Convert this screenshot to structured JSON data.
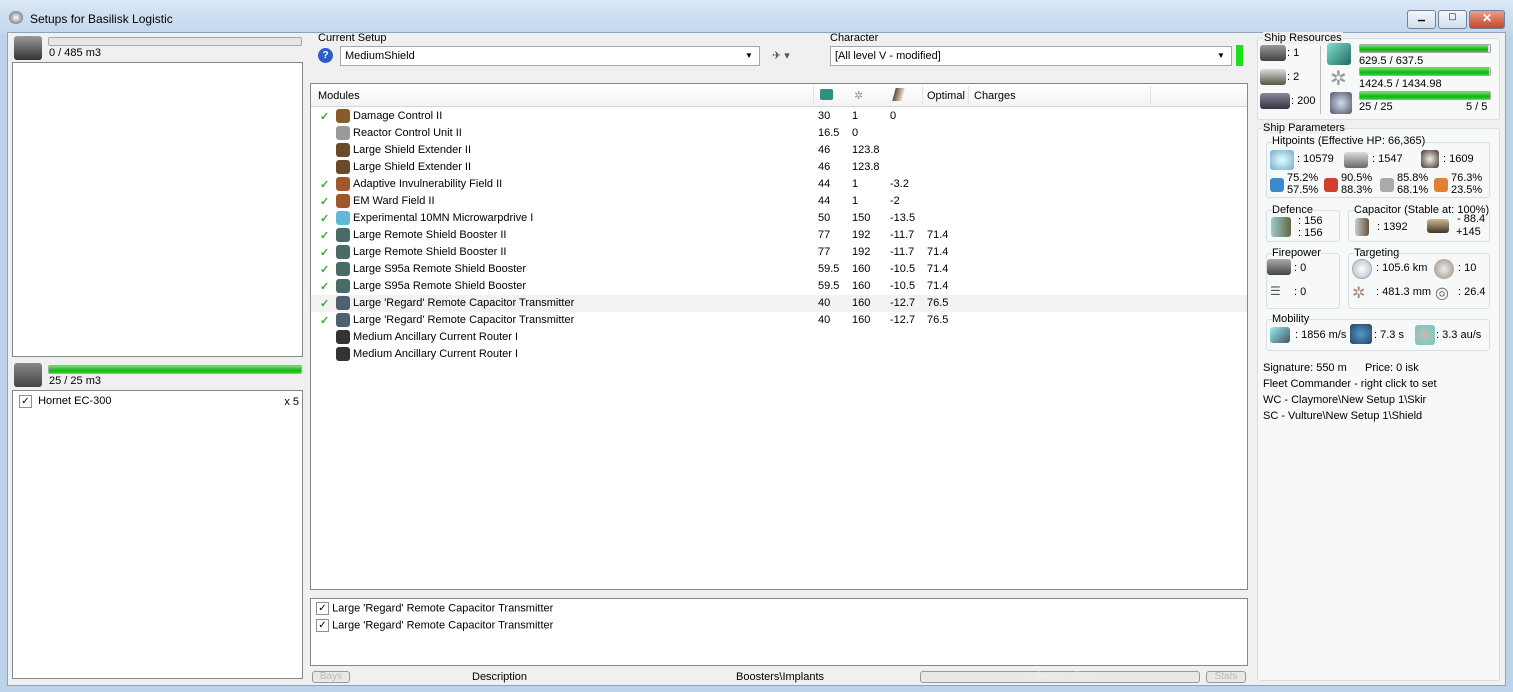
{
  "window": {
    "title": "Setups for Basilisk Logistic"
  },
  "cargo": {
    "label": "0 / 485 m3",
    "fraction": 0.0
  },
  "drones": {
    "label": "25 / 25 m3",
    "fraction": 1.0,
    "items": [
      {
        "name": "Hornet EC-300",
        "qty": "x 5",
        "checked": true
      }
    ]
  },
  "setup": {
    "label": "Current Setup",
    "value": "MediumShield"
  },
  "character": {
    "label": "Character",
    "value": "[All level V - modified]"
  },
  "modules": {
    "headers": [
      "Modules",
      "",
      "",
      "",
      "Optimal",
      "Charges"
    ],
    "rows": [
      {
        "active": true,
        "name": "Damage Control II",
        "cpu": "30",
        "pg": "1",
        "cap": "0",
        "optimal": "",
        "color": "#8a5a2a"
      },
      {
        "active": false,
        "name": "Reactor Control Unit II",
        "cpu": "16.5",
        "pg": "0",
        "cap": "",
        "optimal": "",
        "color": "#9a9a9a"
      },
      {
        "active": false,
        "name": "Large Shield Extender II",
        "cpu": "46",
        "pg": "123.8",
        "cap": "",
        "optimal": "",
        "color": "#6b4a2a"
      },
      {
        "active": false,
        "name": "Large Shield Extender II",
        "cpu": "46",
        "pg": "123.8",
        "cap": "",
        "optimal": "",
        "color": "#6b4a2a"
      },
      {
        "active": true,
        "name": "Adaptive Invulnerability Field II",
        "cpu": "44",
        "pg": "1",
        "cap": "-3.2",
        "optimal": "",
        "color": "#a0582a"
      },
      {
        "active": true,
        "name": "EM Ward Field II",
        "cpu": "44",
        "pg": "1",
        "cap": "-2",
        "optimal": "",
        "color": "#a0582a"
      },
      {
        "active": true,
        "name": "Experimental 10MN Microwarpdrive I",
        "cpu": "50",
        "pg": "150",
        "cap": "-13.5",
        "optimal": "",
        "color": "#5fb8d8"
      },
      {
        "active": true,
        "name": "Large Remote Shield Booster II",
        "cpu": "77",
        "pg": "192",
        "cap": "-11.7",
        "optimal": "71.4",
        "color": "#4a6a6a"
      },
      {
        "active": true,
        "name": "Large Remote Shield Booster II",
        "cpu": "77",
        "pg": "192",
        "cap": "-11.7",
        "optimal": "71.4",
        "color": "#4a6a6a"
      },
      {
        "active": true,
        "name": "Large S95a Remote Shield Booster",
        "cpu": "59.5",
        "pg": "160",
        "cap": "-10.5",
        "optimal": "71.4",
        "color": "#4a6a6a"
      },
      {
        "active": true,
        "name": "Large S95a Remote Shield Booster",
        "cpu": "59.5",
        "pg": "160",
        "cap": "-10.5",
        "optimal": "71.4",
        "color": "#4a6a6a"
      },
      {
        "active": true,
        "name": "Large 'Regard' Remote Capacitor Transmitter",
        "cpu": "40",
        "pg": "160",
        "cap": "-12.7",
        "optimal": "76.5",
        "color": "#506070"
      },
      {
        "active": true,
        "name": "Large 'Regard' Remote Capacitor Transmitter",
        "cpu": "40",
        "pg": "160",
        "cap": "-12.7",
        "optimal": "76.5",
        "color": "#506070"
      },
      {
        "active": false,
        "name": "Medium Ancillary Current Router I",
        "cpu": "",
        "pg": "",
        "cap": "",
        "optimal": "",
        "color": "#333"
      },
      {
        "active": false,
        "name": "Medium Ancillary Current Router I",
        "cpu": "",
        "pg": "",
        "cap": "",
        "optimal": "",
        "color": "#333"
      }
    ]
  },
  "projected": [
    {
      "name": "Large 'Regard' Remote Capacitor Transmitter",
      "checked": true
    },
    {
      "name": "Large 'Regard' Remote Capacitor Transmitter",
      "checked": true
    }
  ],
  "bottom_tabs": [
    "Bays",
    "Description",
    "Boosters\\Implants",
    "Projected effects",
    "Stats"
  ],
  "resources": {
    "title": "Ship Resources",
    "turrets": ": 1",
    "launchers": ": 2",
    "calibration": ": 200",
    "cpu": {
      "label": "629.5 / 637.5",
      "fraction": 0.987
    },
    "powergrid": {
      "label": "1424.5 / 1434.98",
      "fraction": 0.993
    },
    "drone_bw": {
      "label": "25 / 25",
      "fraction": 1.0
    },
    "drones_active": "5 / 5"
  },
  "parameters": {
    "title": "Ship Parameters",
    "hitpoints": {
      "title": "Hitpoints (Effective HP: 66,365)",
      "shield": ": 10579",
      "armor": ": 1547",
      "structure": ": 1609",
      "resists": [
        [
          "75.2%",
          "57.5%"
        ],
        [
          "90.5%",
          "88.3%"
        ],
        [
          "85.8%",
          "68.1%"
        ],
        [
          "76.3%",
          "23.5%"
        ]
      ]
    },
    "defence": {
      "title": "Defence",
      "a": ": 156",
      "b": ": 156"
    },
    "capacitor": {
      "title": "Capacitor (Stable at: 100%)",
      "amount": ": 1392",
      "use": "- 88.4",
      "recharge": "+145"
    },
    "firepower": {
      "title": "Firepower",
      "a": ": 0",
      "b": ": 0"
    },
    "targeting": {
      "title": "Targeting",
      "range": ": 105.6 km",
      "targets": ": 10",
      "resolution": ": 481.3 mm",
      "sensor": ": 26.4"
    },
    "mobility": {
      "title": "Mobility",
      "speed": ": 1856 m/s",
      "align": ": 7.3 s",
      "warp": ": 3.3 au/s"
    },
    "signature": "Signature: 550 m",
    "price": "Price: 0 isk",
    "fleet": "Fleet Commander - right click to set",
    "wc": "WC - Claymore\\New Setup 1\\Skir",
    "sc": "SC - Vulture\\New Setup 1\\Shield"
  }
}
